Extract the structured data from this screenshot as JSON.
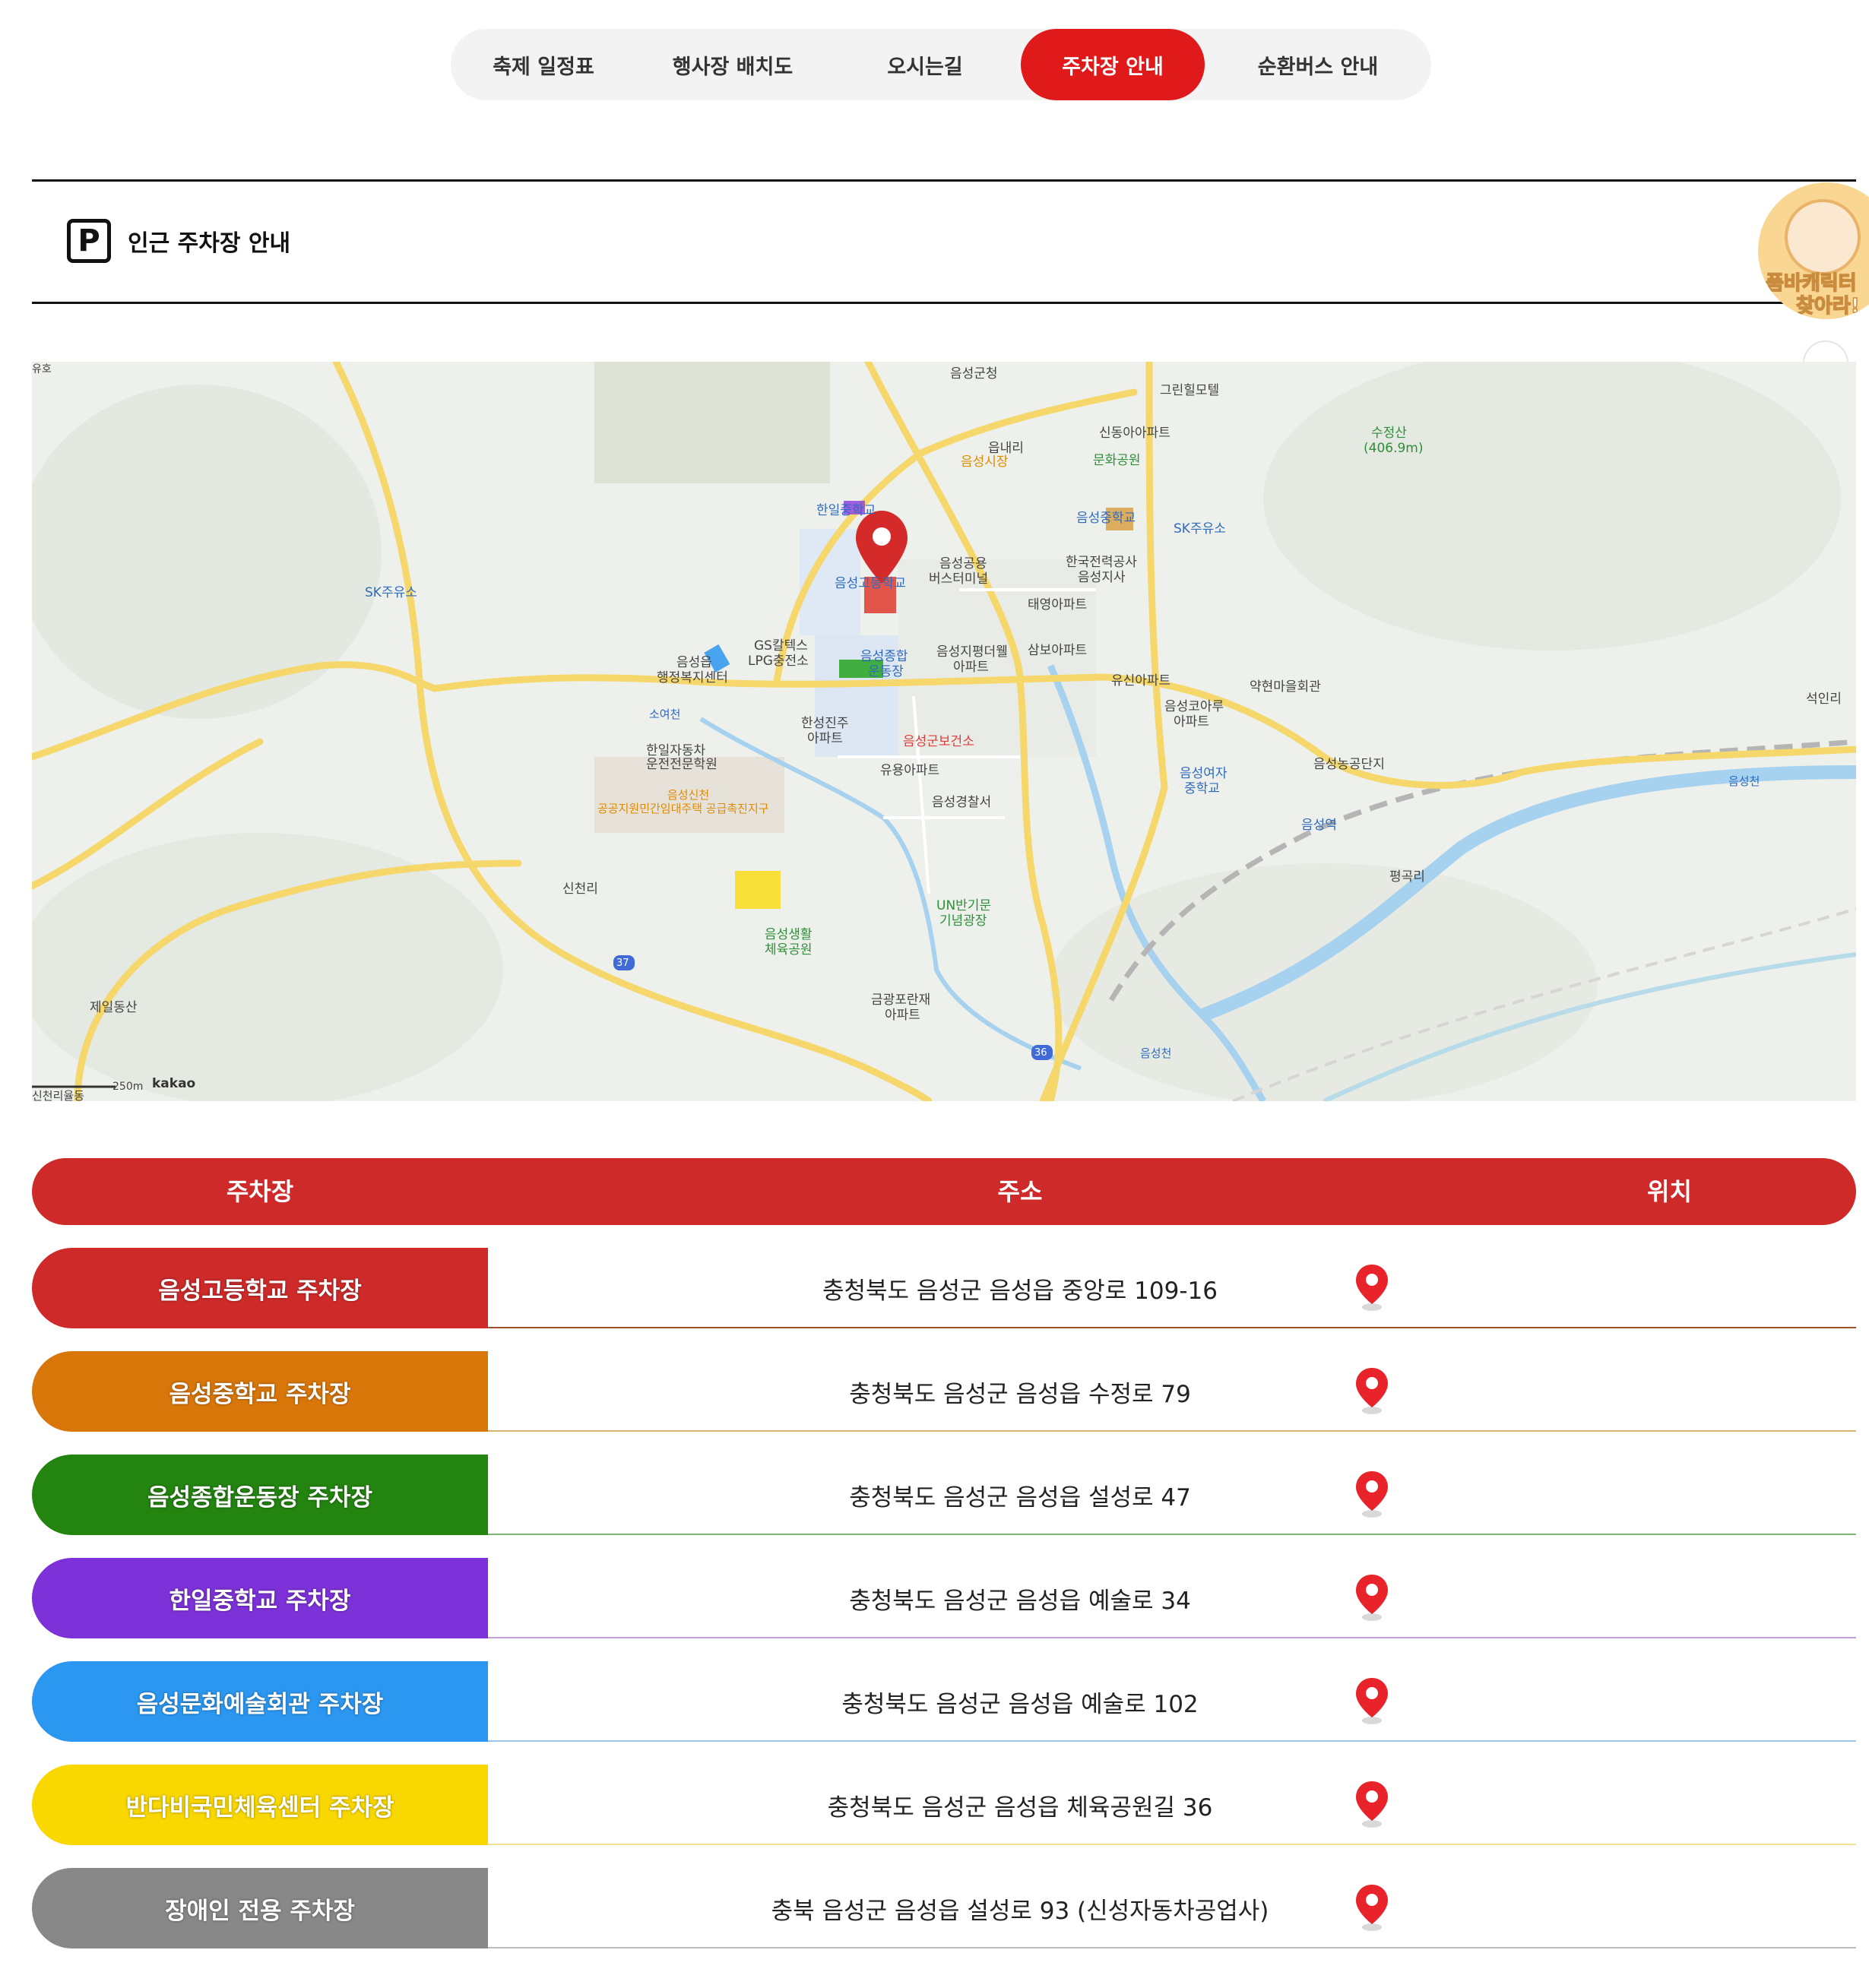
{
  "tabs": [
    {
      "label": "축제 일정표",
      "active": false
    },
    {
      "label": "행사장 배치도",
      "active": false
    },
    {
      "label": "오시는길",
      "active": false
    },
    {
      "label": "주차장 안내",
      "active": true
    },
    {
      "label": "순환버스 안내",
      "active": false
    }
  ],
  "section": {
    "icon_letter": "P",
    "title": "인근 주차장 안내"
  },
  "badge": {
    "line1": "품바캐릭터",
    "line2": "찾아라!"
  },
  "map": {
    "labels": {
      "gun_office": "음성군청",
      "green_motel": "그린힐모텔",
      "sudong_apt": "신동아아파트",
      "geumnae": "읍내리",
      "market": "음성시장",
      "culture_park": "문화공원",
      "sujeongsan": "수정산",
      "sujeongsan_h": "(406.9m)",
      "hanil_ms": "한일중학교",
      "eumseong_ms": "음성중학교",
      "sk_east": "SK주유소",
      "sk_west": "SK주유소",
      "kepco1": "한국전력공사",
      "kepco2": "음성지사",
      "bus1": "음성공용",
      "bus2": "버스터미널",
      "eumseong_hs": "음성고등학교",
      "taeyoung": "태영아파트",
      "gs1": "GS칼텍스",
      "gs2": "LPG충전소",
      "welfare1": "음성읍",
      "welfare2": "행정복지센터",
      "stadium1": "음성종합",
      "stadium2": "운동장",
      "pyeongdae1": "음성지평더웰",
      "pyeongdae2": "아파트",
      "sambo": "삼보아파트",
      "yusin": "유신아파트",
      "yakhyeon": "약현마을회관",
      "seokin": "석인리",
      "hanseong1": "한성진주",
      "hanseong2": "아파트",
      "korea1": "음성코아루",
      "korea2": "아파트",
      "soyeocheon": "소여천",
      "health": "음성군보건소",
      "hanil_drive1": "한일자동차",
      "hanil_drive2": "운전전문학원",
      "yuyoung": "유용아파트",
      "girls1": "음성여자",
      "girls2": "중학교",
      "farm": "음성농공단지",
      "police": "음성경찰서",
      "sinchon1": "음성신천",
      "sinchon2": "공공지원민간임대주택 공급촉진지구",
      "station": "음성역",
      "eumseongcheon": "음성천",
      "soyeocheon2": "소여천",
      "pyeonggok": "평곡리",
      "sincheon": "신천리",
      "un1": "UN반기문",
      "un2": "기념광장",
      "sports1": "음성생활",
      "sports2": "체육공원",
      "jeil": "제일동산",
      "geumgwang1": "금광포란재",
      "geumgwang2": "아파트",
      "road37": "37",
      "road36": "36",
      "eumseongcheon2": "음성천",
      "sinchon_bottom": "신천리율동",
      "scale": "250m",
      "brand": "kakao",
      "top_left": "유호"
    }
  },
  "table": {
    "headers": {
      "lot": "주차장",
      "address": "주소",
      "location": "위치"
    },
    "rows": [
      {
        "name": "음성고등학교 주차장",
        "address": "충청북도 음성군 음성읍 중앙로 109-16",
        "color": "#cf2a2a",
        "line": "#a0522d"
      },
      {
        "name": "음성중학교 주차장",
        "address": "충청북도 음성군 음성읍 수정로 79",
        "color": "#d8760a",
        "line": "#d8b26e"
      },
      {
        "name": "음성종합운동장 주차장",
        "address": "충청북도 음성군 음성읍 설성로 47",
        "color": "#238410",
        "line": "#7fb77a"
      },
      {
        "name": "한일중학교 주차장",
        "address": "충청북도 음성군 음성읍 예술로 34",
        "color": "#7c32d8",
        "line": "#c0a0d8"
      },
      {
        "name": "음성문화예술회관 주차장",
        "address": "충청북도 음성군 음성읍 예술로 102",
        "color": "#2b97f0",
        "line": "#98c6ee"
      },
      {
        "name": "반다비국민체육센터 주차장",
        "address": "충청북도 음성군 음성읍 체육공원길 36",
        "color": "#f9d700",
        "line": "#efe290"
      },
      {
        "name": "장애인 전용 주차장",
        "address": "충북 음성군 음성읍 설성로 93 (신성자동차공업사)",
        "color": "#888888",
        "line": "#bbbbbb"
      }
    ]
  },
  "colors": {
    "accent": "#e0191b",
    "header": "#cf2a2a",
    "pin": "#e8232a"
  },
  "icons": {
    "parking": "parking-icon",
    "location": "location-pin-icon",
    "map_marker": "map-marker-icon"
  }
}
